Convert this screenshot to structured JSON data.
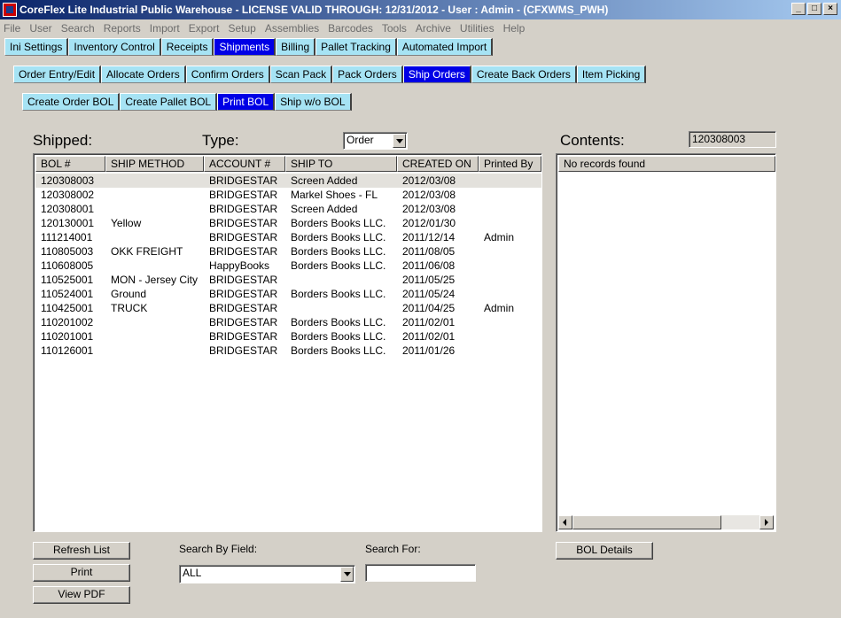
{
  "window": {
    "title": "CoreFlex Lite Industrial Public Warehouse - LICENSE VALID THROUGH: 12/31/2012 - User : Admin - (CFXWMS_PWH)",
    "controls": [
      "_",
      "□",
      "×"
    ]
  },
  "menu": [
    "File",
    "User",
    "Search",
    "Reports",
    "Import",
    "Export",
    "Setup",
    "Assemblies",
    "Barcodes",
    "Tools",
    "Archive",
    "Utilities",
    "Help"
  ],
  "tabs_main": [
    "Ini Settings",
    "Inventory Control",
    "Receipts",
    "Shipments",
    "Billing",
    "Pallet Tracking",
    "Automated Import"
  ],
  "tabs_shipments": [
    "Order Entry/Edit",
    "Allocate Orders",
    "Confirm Orders",
    "Scan Pack",
    "Pack Orders",
    "Ship Orders",
    "Create Back Orders",
    "Item Picking"
  ],
  "tabs_ship": [
    "Create Order BOL",
    "Create Pallet BOL",
    "Print BOL",
    "Ship w/o BOL"
  ],
  "labels": {
    "shipped": "Shipped:",
    "type": "Type:",
    "contents": "Contents:",
    "search_by_field": "Search By Field:",
    "search_for": "Search For:"
  },
  "type_select": "Order",
  "contents_value": "120308003",
  "columns": [
    "BOL #",
    "SHIP METHOD",
    "ACCOUNT #",
    "SHIP TO",
    "CREATED ON",
    "Printed By"
  ],
  "rows": [
    [
      "120308003",
      "",
      "BRIDGESTAR",
      "Screen Added",
      "2012/03/08",
      ""
    ],
    [
      "120308002",
      "",
      "BRIDGESTAR",
      "Markel Shoes - FL",
      "2012/03/08",
      ""
    ],
    [
      "120308001",
      "",
      "BRIDGESTAR",
      "Screen Added",
      "2012/03/08",
      ""
    ],
    [
      "120130001",
      "Yellow",
      "BRIDGESTAR",
      "Borders Books LLC.",
      "2012/01/30",
      ""
    ],
    [
      "111214001",
      "",
      "BRIDGESTAR",
      "Borders Books LLC.",
      "2011/12/14",
      "Admin"
    ],
    [
      "110805003",
      "OKK FREIGHT",
      "BRIDGESTAR",
      "Borders Books LLC.",
      "2011/08/05",
      ""
    ],
    [
      "110608005",
      "",
      "HappyBooks",
      "Borders Books LLC.",
      "2011/06/08",
      ""
    ],
    [
      "110525001",
      "MON - Jersey City",
      "BRIDGESTAR",
      "",
      "2011/05/25",
      ""
    ],
    [
      "110524001",
      "Ground",
      "BRIDGESTAR",
      "Borders Books LLC.",
      "2011/05/24",
      ""
    ],
    [
      "110425001",
      "TRUCK",
      "BRIDGESTAR",
      "",
      "2011/04/25",
      "Admin"
    ],
    [
      "110201002",
      "",
      "BRIDGESTAR",
      "Borders Books LLC.",
      "2011/02/01",
      ""
    ],
    [
      "110201001",
      "",
      "BRIDGESTAR",
      "Borders Books LLC.",
      "2011/02/01",
      ""
    ],
    [
      "110126001",
      "",
      "BRIDGESTAR",
      "Borders Books LLC.",
      "2011/01/26",
      ""
    ]
  ],
  "contents_header": "No records found",
  "buttons": {
    "refresh": "Refresh List",
    "print": "Print",
    "view_pdf": "View PDF",
    "bol_details": "BOL Details"
  },
  "search_field_select": "ALL",
  "search_for_value": ""
}
